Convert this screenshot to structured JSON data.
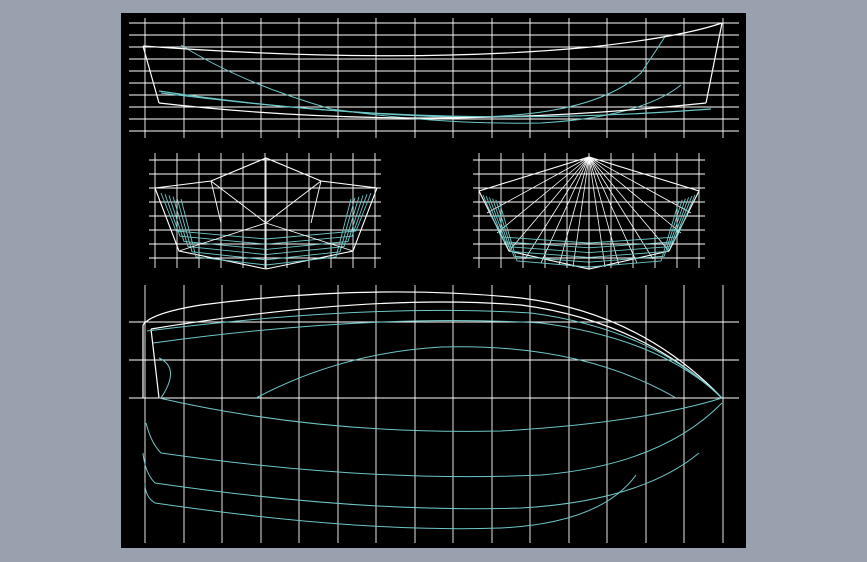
{
  "window": {
    "background_color": "#9aa1ae"
  },
  "viewport": {
    "background_color": "#000000",
    "grid_color": "#ffffff",
    "primary_line_color": "#ffffff",
    "secondary_line_color": "#6ec6c6"
  },
  "drawing": {
    "views": [
      "profile-view",
      "section-view-stern",
      "section-view-bow",
      "plan-view"
    ]
  }
}
